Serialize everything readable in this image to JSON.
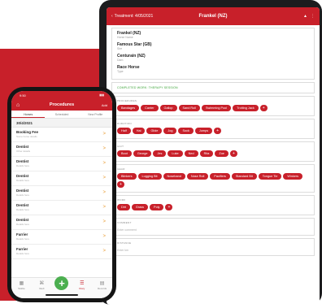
{
  "colors": {
    "accent": "#c8202a",
    "add": "#4caf50",
    "status": "#3aa336",
    "chevron": "#e89a30"
  },
  "tablet": {
    "back_label": "Treatment: 4/05/2021",
    "title": "Frankel (NZ)",
    "horses": [
      {
        "name": "Frankel (NZ)",
        "sub": "Horse Name"
      },
      {
        "name": "Famous Star (GB)",
        "sub": "Sire"
      },
      {
        "name": "Centurain (NZ)",
        "sub": "Dam"
      },
      {
        "name": "Race Horse",
        "sub": "Type"
      }
    ],
    "status": "COMPLETED WORK: THERAPY SESSION",
    "sections": [
      {
        "label": "PROCEDURES",
        "chips": [
          "Bandages",
          "Canter",
          "Gallop",
          "Sand Roll",
          "Swimming Pool",
          "Trotting Jack"
        ]
      },
      {
        "label": "DURATION",
        "chips": [
          "Half",
          "Hal",
          "Glide",
          "Jog",
          "Sock",
          "Jumps"
        ]
      },
      {
        "label": "GAIT",
        "chips": [
          "Boot",
          "George",
          "Jes",
          "Luke",
          "Ned",
          "Rita",
          "Zoe"
        ]
      },
      {
        "label": "GEAR",
        "chips": [
          "Blinkers",
          "Lugging Bit",
          "Noseband",
          "Nose Roll",
          "Pacifiers",
          "Standard Bit",
          "Tongue Tie",
          "Winkers"
        ]
      },
      {
        "label": "WORK",
        "chips": [
          "Dirt",
          "Grass",
          "Poly"
        ]
      }
    ],
    "fields": [
      {
        "label": "COMMENT",
        "value": "Enter comment"
      },
      {
        "label": "DISTANCE",
        "value": "Enter km"
      }
    ]
  },
  "phone": {
    "time": "9:50",
    "title": "Procedures",
    "add_label": "Add",
    "tabs": [
      "Horses",
      "Scheduled",
      "New Profile"
    ],
    "date": "30/4/2021",
    "rows": [
      {
        "title": "Booking Fee",
        "sub": "Some horse details"
      },
      {
        "title": "Dentist",
        "sub": "Other details"
      },
      {
        "title": "Dentist",
        "sub": "Details here"
      },
      {
        "title": "Dentist",
        "sub": "Details here"
      },
      {
        "title": "Dentist",
        "sub": "Details here"
      },
      {
        "title": "Dentist",
        "sub": "Details here"
      },
      {
        "title": "Dentist",
        "sub": "Details here"
      },
      {
        "title": "Farrier",
        "sub": "Details here"
      },
      {
        "title": "Farrier",
        "sub": "Details here"
      },
      {
        "title": "Farrier",
        "sub": "Details here"
      }
    ],
    "tabbar": [
      "Stable",
      "Vault",
      "",
      "Diary",
      "Records"
    ]
  }
}
